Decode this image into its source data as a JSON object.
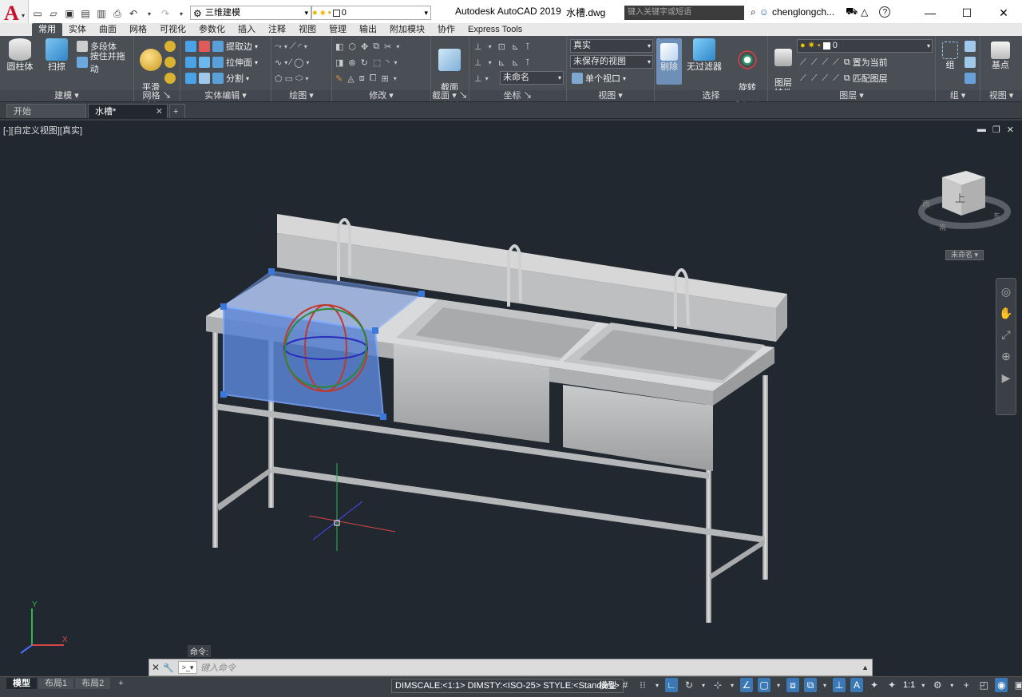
{
  "title_bar": {
    "app_letter": "A",
    "workspace": "三维建模",
    "layer_value": "0",
    "app_title": "Autodesk AutoCAD 2019",
    "file_title": "水槽.dwg",
    "search_placeholder": "键入关键字或短语",
    "user": "chenglongch..."
  },
  "ribbon_tabs": [
    "常用",
    "实体",
    "曲面",
    "网格",
    "可视化",
    "参数化",
    "插入",
    "注释",
    "视图",
    "管理",
    "输出",
    "附加模块",
    "协作",
    "Express Tools"
  ],
  "active_ribbon_tab": "常用",
  "ribbon": {
    "modeling": {
      "title": "建模",
      "cylinder": "圆柱体",
      "sweep": "扫掠",
      "polysolid": "多段体",
      "presspull": "按住并拖动"
    },
    "mesh": {
      "title": "网格",
      "smooth": "平滑\n对象"
    },
    "solid_editing": {
      "title": "实体编辑",
      "extract_edges": "提取边",
      "extrude_faces": "拉伸面",
      "separate": "分割"
    },
    "draw": {
      "title": "绘图"
    },
    "modify": {
      "title": "修改"
    },
    "section": {
      "title": "截面",
      "section_plane": "截面\n平面"
    },
    "coordinates": {
      "title": "坐标",
      "ucs_name": "未命名"
    },
    "view": {
      "title": "视图",
      "visual_style": "真实",
      "saved_view": "未保存的视图",
      "viewport": "单个视口"
    },
    "selection": {
      "title": "选择",
      "culling": "剔除",
      "no_filter": "无过滤器",
      "gizmo": "旋转\n小控件"
    },
    "layers": {
      "title": "图层",
      "layer_props": "图层\n特性",
      "layer_value": "0",
      "set_current": "置为当前",
      "match_layer": "匹配图层"
    },
    "groups": {
      "title": "组",
      "group": "组"
    },
    "view2": {
      "title": "视图",
      "base": "基点"
    }
  },
  "doc_tabs": [
    {
      "label": "开始"
    },
    {
      "label": "水槽*"
    }
  ],
  "viewport": {
    "label": "[-][自定义视图][真实]",
    "viewcube_face": "上",
    "viewcube_east": "东",
    "viewcube_south": "南",
    "viewcube_west": "西",
    "ucs_dropdown": "未命名"
  },
  "command": {
    "label": "命令:",
    "placeholder": "键入命令"
  },
  "layout_tabs": [
    "模型",
    "布局1",
    "布局2"
  ],
  "status": {
    "info": "DIMSCALE:<1:1> DIMSTY:<ISO-25> STYLE:<Standard>",
    "model": "模型",
    "scale": "1:1"
  },
  "colors": {
    "selection_blue": "#5b84d4",
    "viewport_bg": "#212830",
    "ribbon_bg": "#4a4f55"
  }
}
